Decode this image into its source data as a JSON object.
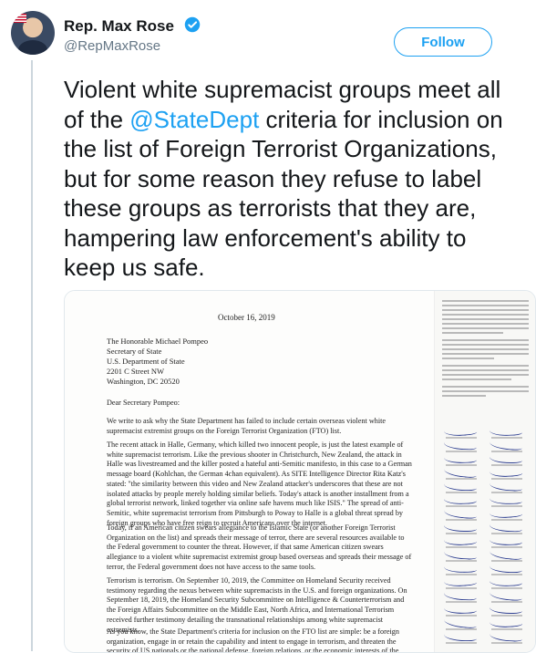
{
  "author": {
    "name": "Rep. Max Rose",
    "handle": "@RepMaxRose",
    "verified": true
  },
  "follow_label": "Follow",
  "tweet": {
    "text_before": "Violent white supremacist groups meet all of the ",
    "mention": "@StateDept",
    "text_after": " criteria for inclusion on the list of Foreign Terrorist Organizations, but for some reason they refuse to label these groups as terrorists that they are, hampering law enforcement's ability to keep us safe."
  },
  "letter": {
    "date": "October 16, 2019",
    "address": [
      "The Honorable Michael Pompeo",
      "Secretary of State",
      "U.S. Department of State",
      "2201 C Street NW",
      "Washington, DC 20520"
    ],
    "salutation": "Dear Secretary Pompeo:",
    "paragraphs": [
      "We write to ask why the State Department has failed to include certain overseas violent white supremacist extremist groups on the Foreign Terrorist Organization (FTO) list.",
      "The recent attack in Halle, Germany, which killed two innocent people, is just the latest example of white supremacist terrorism. Like the previous shooter in Christchurch, New Zealand, the attack in Halle was livestreamed and the killer posted a hateful anti-Semitic manifesto, in this case to a German message board (Kohlchan, the German 4chan equivalent). As SITE Intelligence Director Rita Katz's stated: \"the similarity between this video and New Zealand attacker's underscores that these are not isolated attacks by people merely holding similar beliefs. Today's attack is another installment from a global terrorist network, linked together via online safe havens much like ISIS.\" The spread of anti-Semitic, white supremacist terrorism from Pittsburgh to Poway to Halle is a global threat spread by foreign groups who have free reign to recruit Americans over the internet.",
      "Today, if an American citizen swears allegiance to the Islamic State (or another Foreign Terrorist Organization on the list) and spreads their message of terror, there are several resources available to the Federal government to counter the threat. However, if that same American citizen swears allegiance to a violent white supremacist extremist group based overseas and spreads their message of terror, the Federal government does not have access to the same tools.",
      "Terrorism is terrorism. On September 10, 2019, the Committee on Homeland Security received testimony regarding the nexus between white supremacists in the U.S. and foreign organizations. On September 18, 2019, the Homeland Security Subcommittee on Intelligence & Counterterrorism and the Foreign Affairs Subcommittee on the Middle East, North Africa, and International Terrorism received further testimony detailing the transnational relationships among white supremacist extremists.",
      "As you know, the State Department's criteria for inclusion on the FTO list are simple: be a foreign organization, engage in or retain the capability and intent to engage in terrorism, and threaten the security of US nationals or the national defense, foreign relations, or the economic interests of the United States. There are numerous examples of foreign white nationalist groups that fit these conditions. The American people deserve an explanation as to why these groups are"
    ]
  },
  "colors": {
    "accent": "#1da1f2",
    "text": "#14171a",
    "muted": "#657786"
  }
}
